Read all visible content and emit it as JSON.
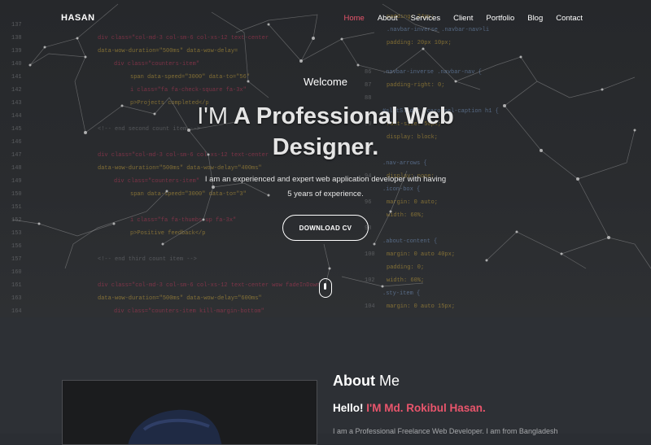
{
  "nav": {
    "brand": "HASAN",
    "items": [
      "Home",
      "About",
      "Services",
      "Client",
      "Portfolio",
      "Blog",
      "Contact"
    ],
    "active": "Home"
  },
  "hero": {
    "welcome": "Welcome",
    "headline_prefix": "I'M",
    "headline_rest": "A Professional Web Designer.",
    "description_line1": "I am an experienced and expert web application developer with having",
    "description_line2": "5 years of experience.",
    "cta_label": "DOWNLOAD CV",
    "scroll_icon": "mouse-scroll-icon"
  },
  "about": {
    "title_bold": "About",
    "title_rest": "Me",
    "hello_prefix": "Hello!",
    "hello_name": "I'M Md. Rokibul Hasan.",
    "text": "I am a Professional Freelance Web Developer. I am from Bangladesh"
  },
  "colors": {
    "accent": "#e9556c",
    "background": "#2b2e33"
  }
}
